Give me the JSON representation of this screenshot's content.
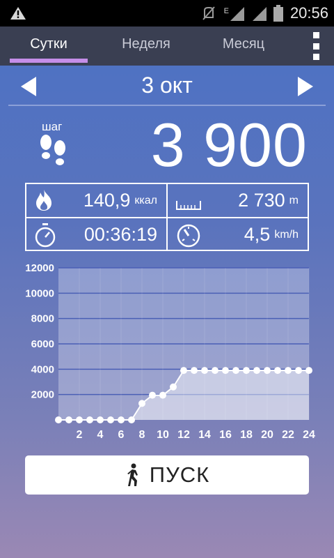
{
  "status_bar": {
    "time": "20:56",
    "network_label": "E"
  },
  "tabs": [
    {
      "label": "Сутки"
    },
    {
      "label": "Неделя"
    },
    {
      "label": "Месяц"
    }
  ],
  "date_nav": {
    "date": "3 окт"
  },
  "steps": {
    "label": "шаг",
    "value": "3 900"
  },
  "stats": {
    "calories": {
      "value": "140,9",
      "unit": "ккал"
    },
    "distance": {
      "value": "2 730",
      "unit": "m"
    },
    "duration": {
      "value": "00:36:19"
    },
    "speed": {
      "value": "4,5",
      "unit": "km/h"
    }
  },
  "start_button": {
    "label": "ПУСК"
  },
  "chart_data": {
    "type": "area",
    "x": [
      0,
      1,
      2,
      3,
      4,
      5,
      6,
      7,
      8,
      9,
      10,
      11,
      12,
      13,
      14,
      15,
      16,
      17,
      18,
      19,
      20,
      21,
      22,
      23,
      24
    ],
    "values": [
      0,
      0,
      0,
      0,
      0,
      0,
      0,
      0,
      1300,
      1950,
      1950,
      2600,
      3900,
      3900,
      3900,
      3900,
      3900,
      3900,
      3900,
      3900,
      3900,
      3900,
      3900,
      3900,
      3900
    ],
    "x_tick_labels": [
      "2",
      "4",
      "6",
      "8",
      "10",
      "12",
      "14",
      "16",
      "18",
      "20",
      "22",
      "24"
    ],
    "y_tick_labels": [
      "2000",
      "4000",
      "6000",
      "8000",
      "10000",
      "12000"
    ],
    "xlim": [
      0,
      24
    ],
    "ylim": [
      0,
      12000
    ],
    "grid": true
  }
}
